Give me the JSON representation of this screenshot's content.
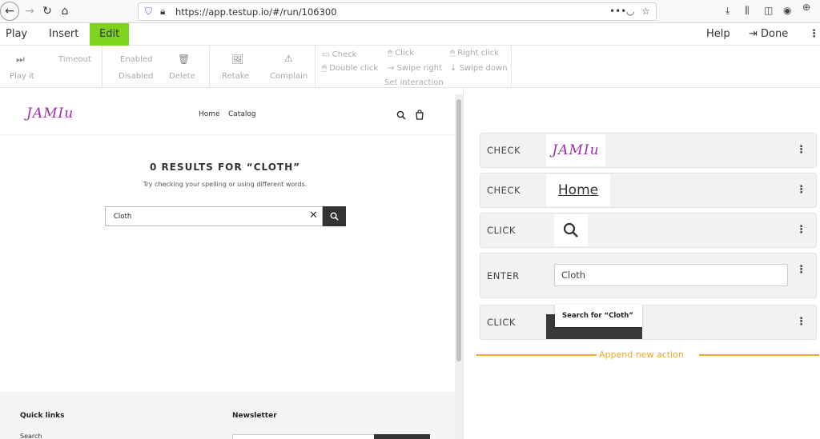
{
  "browser": {
    "url": "https://app.testup.io/#/run/106300"
  },
  "menubar": {
    "play": "Play",
    "insert": "Insert",
    "edit": "Edit",
    "help": "Help",
    "done": "Done"
  },
  "actions": {
    "play_it": "Play it",
    "timeout": "Timeout",
    "enabled": "Enabled",
    "disabled": "Disabled",
    "delete": "Delete",
    "retake": "Retake",
    "complain": "Complain",
    "check": "Check",
    "double_click": "Double click",
    "click": "Click",
    "swipe_right": "Swipe right",
    "right_click": "Right click",
    "swipe_down": "Swipe down",
    "set_interaction": "Set interaction"
  },
  "shop": {
    "logo": "JAMIu",
    "nav_home": "Home",
    "nav_catalog": "Catalog",
    "results_title": "0 RESULTS FOR “CLOTH”",
    "results_sub": "Try checking your spelling or using different words.",
    "search_value": "Cloth",
    "footer_quick": "Quick links",
    "footer_search": "Search",
    "footer_newsletter": "Newsletter"
  },
  "steps": [
    {
      "label": "CHECK",
      "thumb": "JAMIu"
    },
    {
      "label": "CHECK",
      "thumb": "Home"
    },
    {
      "label": "CLICK"
    },
    {
      "label": "ENTER",
      "value": "Cloth"
    },
    {
      "label": "CLICK",
      "thumb": "Search for “Cloth”"
    }
  ],
  "append_label": "Append new action",
  "colors": {
    "edit_active": "#7ed321",
    "append": "#f5a623",
    "logo": "#9b2fae"
  }
}
